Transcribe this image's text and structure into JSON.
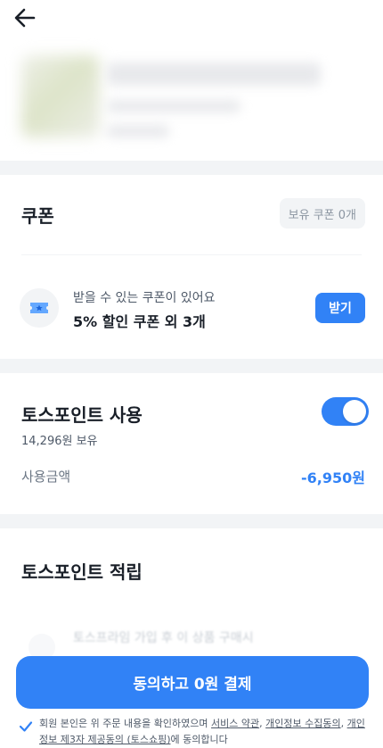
{
  "header": {
    "back_icon": "arrow-left-icon"
  },
  "coupon": {
    "title": "쿠폰",
    "owned_chip": "보유 쿠폰 0개",
    "available_text": "받을 수 있는 쿠폰이 있어요",
    "offer_text": "5% 할인 쿠폰 외 3개",
    "receive_button": "받기",
    "icon": "ticket-icon"
  },
  "toss_points_use": {
    "title": "토스포인트 사용",
    "held": "14,296원 보유",
    "amount_label": "사용금액",
    "amount_value": "-6,950원",
    "toggle_on": true
  },
  "toss_points_earn": {
    "title": "토스포인트 적립",
    "faded_text": "토스프라임 가입 후 이 상품 구매시"
  },
  "pay_button": "동의하고 0원 결제",
  "agreement": {
    "prefix": "회원 본인은 위 주문 내용을 확인하였으며 ",
    "link1": "서비스 약관",
    "sep1": ", ",
    "link2": "개인정보 수집동의",
    "sep2": ", ",
    "link3": "개인정보 제3자 제공동의 (토스쇼핑)",
    "suffix": "에 동의합니다"
  },
  "colors": {
    "accent": "#3182f6",
    "separator": "#f2f4f6",
    "text_primary": "#191f28",
    "text_secondary": "#4e5968"
  }
}
